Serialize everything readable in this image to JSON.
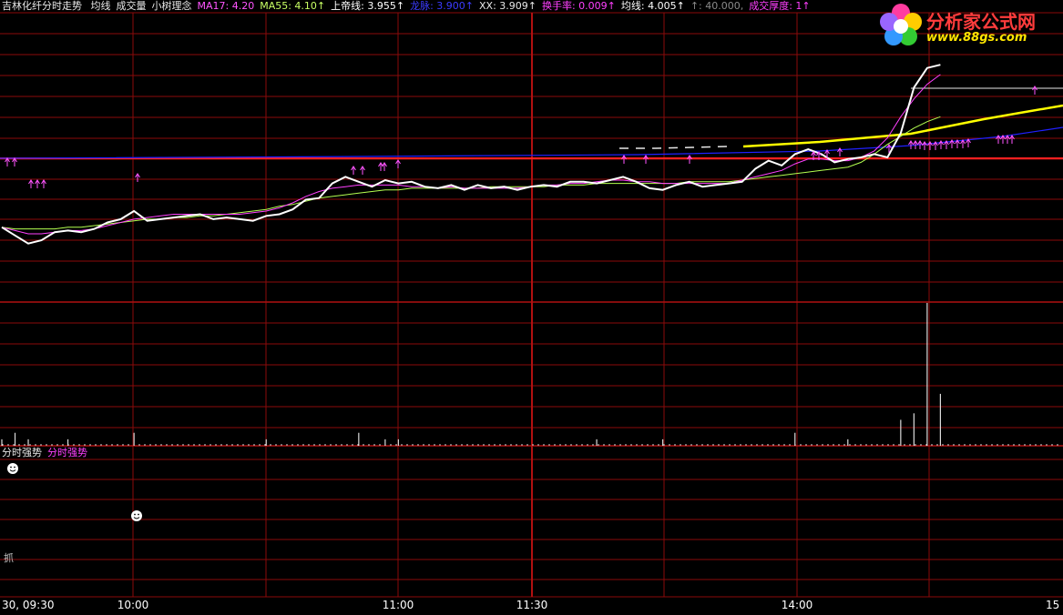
{
  "header": {
    "stock_name": "吉林化纤",
    "indicator_title": "分时走势",
    "items": [
      {
        "text": "均线",
        "color": "#e8e8e8"
      },
      {
        "text": "成交量",
        "color": "#e8e8e8"
      },
      {
        "text": "小树理念",
        "color": "#e8e8e8"
      },
      {
        "text": "MA17: 4.20",
        "color": "#ff55ff"
      },
      {
        "text": "MA55: 4.10↑",
        "color": "#c8ff64"
      },
      {
        "text": "上帝线: 3.955↑",
        "color": "#ffffff"
      },
      {
        "text": "龙脉: 3.900↑",
        "color": "#3b3bff"
      },
      {
        "text": "XX: 3.909↑",
        "color": "#e8e8e8"
      },
      {
        "text": "换手率: 0.009↑",
        "color": "#ff40ff"
      },
      {
        "text": "均线: 4.005↑",
        "color": "#ffffff"
      },
      {
        "text": "↑: 40.000,",
        "color": "#8a8a8a"
      },
      {
        "text": "成交厚度: 1↑",
        "color": "#ff40ff"
      }
    ]
  },
  "logo": {
    "title": "分析家公式网",
    "url": "www.88gs.com"
  },
  "sub_panel": {
    "title": "分时强势",
    "legend": "分时强势",
    "annotation": "抓"
  },
  "colors": {
    "background": "#000000",
    "grid": "#8b0a0a",
    "price": "#ffffff",
    "ma17": "#ff40ff",
    "ma55": "#b4ff50",
    "god_line": "#ffff00",
    "dragon_line": "#2020ff",
    "prev_close": "#ff2020",
    "arrow": "#ff55ff",
    "volume": "#dcdcdc"
  },
  "chart_data": [
    {
      "type": "line",
      "title": "分时走势",
      "x_axis": {
        "ticks": [
          "30, 09:30",
          "10:00",
          "11:00",
          "11:30",
          "14:00",
          "15"
        ],
        "session": "09:30-11:30, 13:00-15:00"
      },
      "series": [
        {
          "name": "分时走势",
          "x": [
            "09:30",
            "09:33",
            "09:36",
            "09:39",
            "09:42",
            "09:45",
            "09:48",
            "09:51",
            "09:54",
            "09:57",
            "10:00",
            "10:03",
            "10:06",
            "10:09",
            "10:12",
            "10:15",
            "10:18",
            "10:21",
            "10:24",
            "10:27",
            "10:30",
            "10:33",
            "10:36",
            "10:39",
            "10:42",
            "10:45",
            "10:48",
            "10:51",
            "10:54",
            "10:57",
            "11:00",
            "11:03",
            "11:06",
            "11:09",
            "11:12",
            "11:15",
            "11:18",
            "11:21",
            "11:24",
            "11:27",
            "11:30",
            "13:03",
            "13:06",
            "13:09",
            "13:12",
            "13:15",
            "13:18",
            "13:21",
            "13:24",
            "13:27",
            "13:30",
            "13:33",
            "13:36",
            "13:39",
            "13:42",
            "13:45",
            "13:48",
            "13:51",
            "13:54",
            "13:57",
            "14:00",
            "14:03",
            "14:06",
            "14:09",
            "14:12",
            "14:15",
            "14:18",
            "14:21",
            "14:24",
            "14:27",
            "14:30",
            "14:33"
          ],
          "values": [
            4.07,
            4.02,
            3.97,
            3.99,
            4.04,
            4.05,
            4.04,
            4.06,
            4.1,
            4.12,
            4.17,
            4.11,
            4.12,
            4.13,
            4.14,
            4.15,
            4.12,
            4.13,
            4.12,
            4.11,
            4.14,
            4.15,
            4.18,
            4.24,
            4.25,
            4.34,
            4.38,
            4.35,
            4.32,
            4.36,
            4.34,
            4.35,
            4.32,
            4.31,
            4.33,
            4.3,
            4.33,
            4.31,
            4.32,
            4.3,
            4.32,
            4.33,
            4.32,
            4.35,
            4.35,
            4.34,
            4.36,
            4.38,
            4.35,
            4.31,
            4.3,
            4.33,
            4.35,
            4.32,
            4.33,
            4.34,
            4.35,
            4.43,
            4.48,
            4.45,
            4.52,
            4.55,
            4.52,
            4.47,
            4.49,
            4.5,
            4.52,
            4.5,
            4.65,
            4.93,
            5.05,
            5.07
          ]
        },
        {
          "name": "MA17",
          "values": [
            4.07,
            4.05,
            4.03,
            4.03,
            4.04,
            4.05,
            4.05,
            4.06,
            4.08,
            4.1,
            4.12,
            4.13,
            4.14,
            4.15,
            4.15,
            4.15,
            4.15,
            4.15,
            4.15,
            4.16,
            4.17,
            4.19,
            4.22,
            4.26,
            4.29,
            4.31,
            4.32,
            4.33,
            4.33,
            4.33,
            4.33,
            4.32,
            4.32,
            4.31,
            4.32,
            4.31,
            4.31,
            4.31,
            4.31,
            4.31,
            4.32,
            4.33,
            4.33,
            4.34,
            4.34,
            4.35,
            4.36,
            4.36,
            4.35,
            4.35,
            4.34,
            4.34,
            4.34,
            4.34,
            4.34,
            4.34,
            4.36,
            4.38,
            4.4,
            4.42,
            4.46,
            4.49,
            4.49,
            4.48,
            4.48,
            4.5,
            4.54,
            4.62,
            4.75,
            4.86,
            4.95,
            5.01
          ]
        },
        {
          "name": "MA55",
          "values": [
            4.07,
            4.06,
            4.06,
            4.06,
            4.06,
            4.07,
            4.07,
            4.08,
            4.09,
            4.1,
            4.11,
            4.12,
            4.12,
            4.13,
            4.13,
            4.14,
            4.14,
            4.15,
            4.16,
            4.17,
            4.18,
            4.2,
            4.21,
            4.23,
            4.25,
            4.26,
            4.27,
            4.28,
            4.29,
            4.3,
            4.3,
            4.31,
            4.31,
            4.31,
            4.31,
            4.31,
            4.31,
            4.32,
            4.32,
            4.32,
            4.32,
            4.32,
            4.33,
            4.33,
            4.33,
            4.34,
            4.34,
            4.34,
            4.34,
            4.34,
            4.34,
            4.34,
            4.35,
            4.35,
            4.35,
            4.35,
            4.36,
            4.37,
            4.38,
            4.39,
            4.4,
            4.41,
            4.42,
            4.43,
            4.44,
            4.47,
            4.52,
            4.58,
            4.63,
            4.68,
            4.72,
            4.75
          ]
        }
      ],
      "volume": [
        {
          "x": "09:30",
          "v": 1
        },
        {
          "x": "09:33",
          "v": 2
        },
        {
          "x": "09:36",
          "v": 1
        },
        {
          "x": "09:45",
          "v": 1
        },
        {
          "x": "10:00",
          "v": 2
        },
        {
          "x": "10:30",
          "v": 1
        },
        {
          "x": "10:51",
          "v": 2
        },
        {
          "x": "10:57",
          "v": 1
        },
        {
          "x": "11:00",
          "v": 1
        },
        {
          "x": "13:15",
          "v": 1
        },
        {
          "x": "13:30",
          "v": 1
        },
        {
          "x": "14:00",
          "v": 2
        },
        {
          "x": "14:12",
          "v": 1
        },
        {
          "x": "14:24",
          "v": 4
        },
        {
          "x": "14:27",
          "v": 5
        },
        {
          "x": "14:30",
          "v": 22
        },
        {
          "x": "14:33",
          "v": 8
        }
      ]
    }
  ]
}
